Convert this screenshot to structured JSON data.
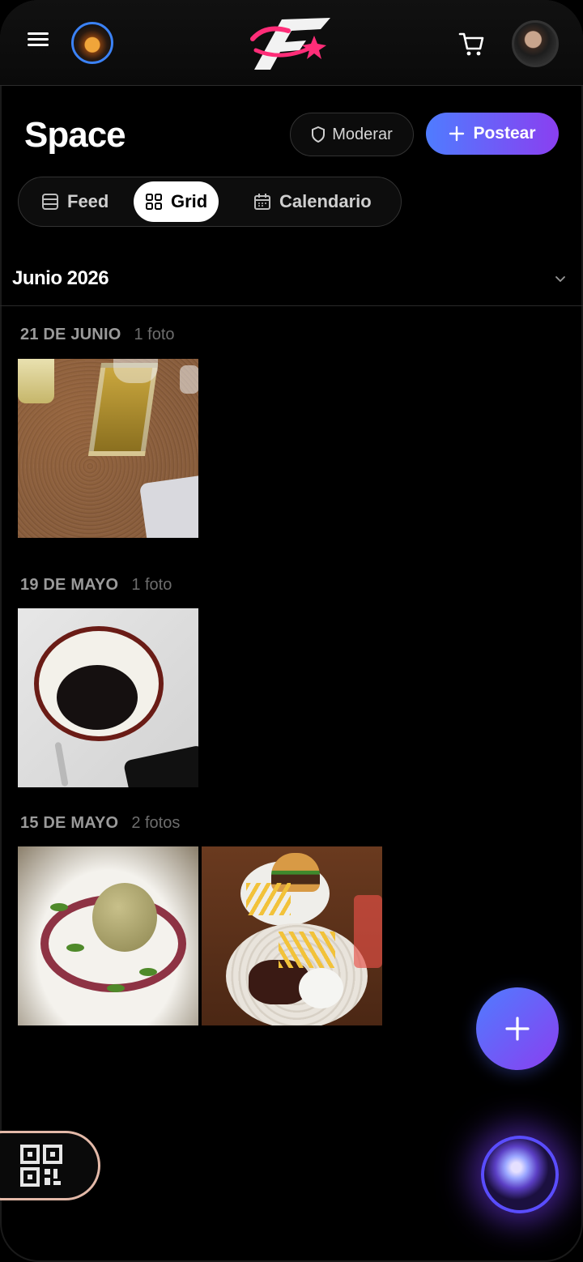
{
  "header": {
    "menu_icon": "hamburger-menu-icon",
    "logo_icon": "app-logo-star-swoosh",
    "cart_icon": "shopping-cart-icon"
  },
  "page": {
    "title": "Space",
    "moderate_label": "Moderar",
    "post_label": "Postear"
  },
  "tabs": [
    {
      "label": "Feed",
      "icon": "list-icon",
      "active": false
    },
    {
      "label": "Grid",
      "icon": "grid-icon",
      "active": true
    },
    {
      "label": "Calendario",
      "icon": "calendar-icon",
      "active": false
    }
  ],
  "month": {
    "label": "Junio 2026"
  },
  "sections": [
    {
      "date": "21 DE JUNIO",
      "count": "1 foto"
    },
    {
      "date": "19 DE MAYO",
      "count": "1 foto"
    },
    {
      "date": "15 DE MAYO",
      "count": "2 fotos"
    }
  ],
  "photos": [
    {
      "subject": "table with glasses and sign",
      "section": 0
    },
    {
      "subject": "coffee cup",
      "section": 1
    },
    {
      "subject": "plated dessert",
      "section": 2
    },
    {
      "subject": "burger and lomo saltado plates",
      "section": 2
    }
  ],
  "colors": {
    "accent_from": "#4f7cff",
    "accent_to": "#8a3ff0",
    "avatar_ring": "#3b82f6",
    "logo_pink": "#ff2d78"
  }
}
